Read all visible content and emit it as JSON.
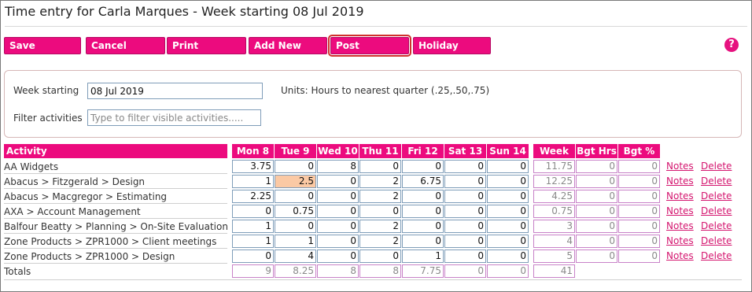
{
  "page": {
    "title": "Time entry for Carla Marques - Week starting 08 Jul 2019"
  },
  "toolbar": {
    "buttons": [
      "Save",
      "Cancel",
      "Print",
      "Add New",
      "Post",
      "Holiday"
    ],
    "help_icon": "?"
  },
  "filters": {
    "week_label": "Week starting",
    "week_value": "08 Jul 2019",
    "units_text": "Units: Hours to nearest quarter (.25,.50,.75)",
    "filter_label": "Filter activities",
    "filter_placeholder": "Type to filter visible activities....."
  },
  "grid": {
    "headers": [
      "Activity",
      "Mon 8",
      "Tue 9",
      "Wed 10",
      "Thu 11",
      "Fri 12",
      "Sat 13",
      "Sun 14",
      "Week",
      "Bgt Hrs",
      "Bgt %"
    ],
    "rows": [
      {
        "activity": "AA Widgets",
        "days": [
          "3.75",
          "0",
          "8",
          "0",
          "0",
          "0",
          "0"
        ],
        "week": "11.75",
        "bgt_hrs": "0",
        "bgt_pct": "0"
      },
      {
        "activity": "Abacus > Fitzgerald > Design",
        "days": [
          "1",
          "2.5",
          "0",
          "2",
          "6.75",
          "0",
          "0"
        ],
        "week": "12.25",
        "bgt_hrs": "0",
        "bgt_pct": "0"
      },
      {
        "activity": "Abacus > Macgregor > Estimating",
        "days": [
          "2.25",
          "0",
          "0",
          "2",
          "0",
          "0",
          "0"
        ],
        "week": "4.25",
        "bgt_hrs": "0",
        "bgt_pct": "0"
      },
      {
        "activity": "AXA > Account Management",
        "days": [
          "0",
          "0.75",
          "0",
          "0",
          "0",
          "0",
          "0"
        ],
        "week": "0.75",
        "bgt_hrs": "0",
        "bgt_pct": "0"
      },
      {
        "activity": "Balfour Beatty > Planning > On-Site Evaluation",
        "days": [
          "1",
          "0",
          "0",
          "2",
          "0",
          "0",
          "0"
        ],
        "week": "3",
        "bgt_hrs": "0",
        "bgt_pct": "0"
      },
      {
        "activity": "Zone Products > ZPR1000 > Client meetings",
        "days": [
          "1",
          "1",
          "0",
          "2",
          "0",
          "0",
          "0"
        ],
        "week": "4",
        "bgt_hrs": "0",
        "bgt_pct": "0"
      },
      {
        "activity": "Zone Products > ZPR1000 > Design",
        "days": [
          "0",
          "4",
          "0",
          "0",
          "1",
          "0",
          "0"
        ],
        "week": "5",
        "bgt_hrs": "0",
        "bgt_pct": "0"
      }
    ],
    "totals_label": "Totals",
    "totals": [
      "9",
      "8.25",
      "8",
      "8",
      "7.75",
      "0",
      "0"
    ],
    "totals_week": "41",
    "row_links": {
      "notes": "Notes",
      "delete": "Delete"
    },
    "highlighted_cell": {
      "row": 1,
      "day": 1,
      "color": "#fbc9a4"
    }
  },
  "colors": {
    "accent": "#ec0b7e",
    "link": "#d4146e",
    "input_border": "#7f9db9",
    "readonly_border": "#c882c8",
    "post_outline": "#d0312d"
  }
}
